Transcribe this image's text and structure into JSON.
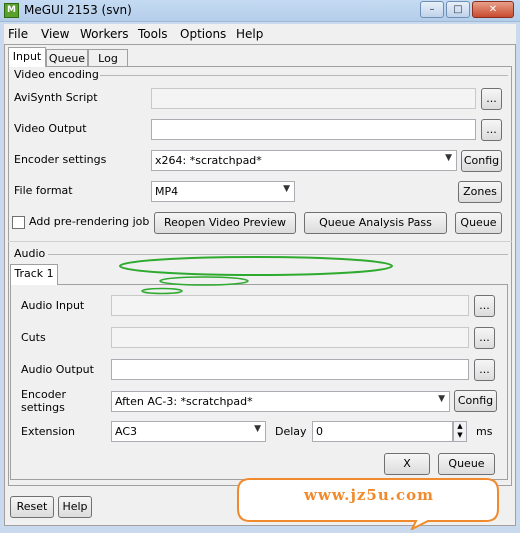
{
  "window": {
    "title": "MeGUI 2153 (svn)",
    "icon_text": "M",
    "buttons": {
      "minimize": "–",
      "maximize": "□",
      "close": "✕"
    }
  },
  "menu": [
    "File",
    "View",
    "Workers",
    "Tools",
    "Options",
    "Help"
  ],
  "tabs": [
    "Input",
    "Queue",
    "Log"
  ],
  "video": {
    "section_title": "Video encoding",
    "avisynth_label": "AviSynth Script",
    "avisynth_value": "",
    "output_label": "Video Output",
    "output_value": "",
    "browse_label": "...",
    "encoder_label": "Encoder settings",
    "encoder_value": "x264: *scratchpad*",
    "config_label": "Config",
    "format_label": "File format",
    "format_value": "MP4",
    "zones_label": "Zones",
    "prerender_label": "Add pre-rendering job",
    "prerender_checked": false,
    "reopen_label": "Reopen Video Preview",
    "analysis_label": "Queue Analysis Pass",
    "queue_label": "Queue"
  },
  "audio": {
    "section_title": "Audio",
    "track_tab": "Track 1",
    "input_label": "Audio Input",
    "input_value": "",
    "cuts_label": "Cuts",
    "cuts_value": "",
    "output_label": "Audio Output",
    "output_value": "",
    "encoder_label_1": "Encoder",
    "encoder_label_2": "settings",
    "encoder_value": "Aften AC-3: *scratchpad*",
    "config_label": "Config",
    "extension_label": "Extension",
    "extension_value": "AC3",
    "delay_label": "Delay",
    "delay_value": "0",
    "delay_unit": "ms",
    "x_label": "X",
    "queue_label": "Queue"
  },
  "footer": {
    "reset_label": "Reset",
    "help_label": "Help"
  },
  "watermark": {
    "text": "www.jz5u.com",
    "color": "#f08a2c"
  }
}
